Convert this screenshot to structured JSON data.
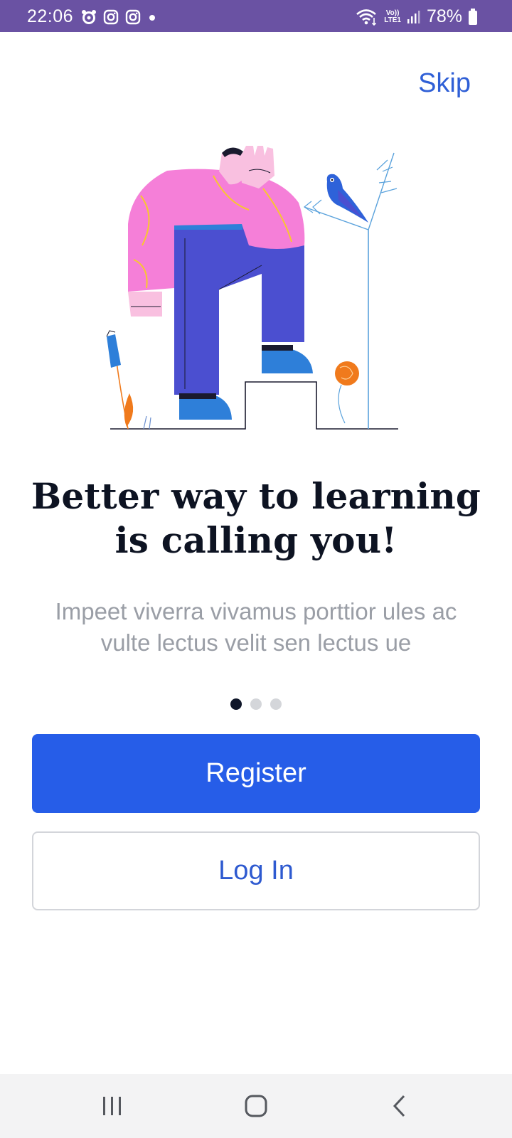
{
  "status_bar": {
    "time": "22:06",
    "battery": "78%",
    "network_top": "Vo))",
    "network_bottom": "LTE1",
    "background_color": "#6a52a3"
  },
  "onboarding": {
    "skip_label": "Skip",
    "headline": "Better way to learning is calling you!",
    "subtitle": "Impeet viverra vivamus porttior ules ac vulte lectus velit sen lectus ue",
    "page_indicator": {
      "current": 1,
      "total": 3
    },
    "register_label": "Register",
    "login_label": "Log In",
    "accent_color": "#265de8"
  },
  "nav_bar": {
    "recents_icon": "recents-icon",
    "home_icon": "home-icon",
    "back_icon": "back-icon"
  }
}
